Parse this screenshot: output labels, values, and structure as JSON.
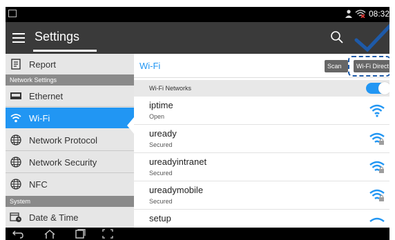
{
  "status_bar": {
    "time": "08:32"
  },
  "action_bar": {
    "title": "Settings",
    "menu_icon": "hamburger-menu-icon",
    "search_icon": "search-icon",
    "confirm_icon": "checkmark-icon"
  },
  "sidebar": {
    "report_label": "Report",
    "section_network": "Network Settings",
    "ethernet_label": "Ethernet",
    "wifi_label": "Wi-Fi",
    "protocol_label": "Network Protocol",
    "security_label": "Network Security",
    "nfc_label": "NFC",
    "section_system": "System",
    "datetime_label": "Date & Time"
  },
  "content": {
    "title": "Wi-Fi",
    "scan_label": "Scan",
    "direct_label": "Wi-Fi Direct",
    "networks_header": "Wi-Fi Networks",
    "wifi_enabled": true,
    "networks": [
      {
        "name": "iptime",
        "status": "Open",
        "secured": false
      },
      {
        "name": "uready",
        "status": "Secured",
        "secured": true
      },
      {
        "name": "ureadyintranet",
        "status": "Secured",
        "secured": true
      },
      {
        "name": "ureadymobile",
        "status": "Secured",
        "secured": true
      },
      {
        "name": "setup",
        "status": "",
        "secured": false
      }
    ]
  },
  "colors": {
    "accent": "#2196f3",
    "action_bar": "#3a3a3a",
    "sidebar_bg": "#e6e6e6",
    "section_header": "#8a8a8a"
  }
}
